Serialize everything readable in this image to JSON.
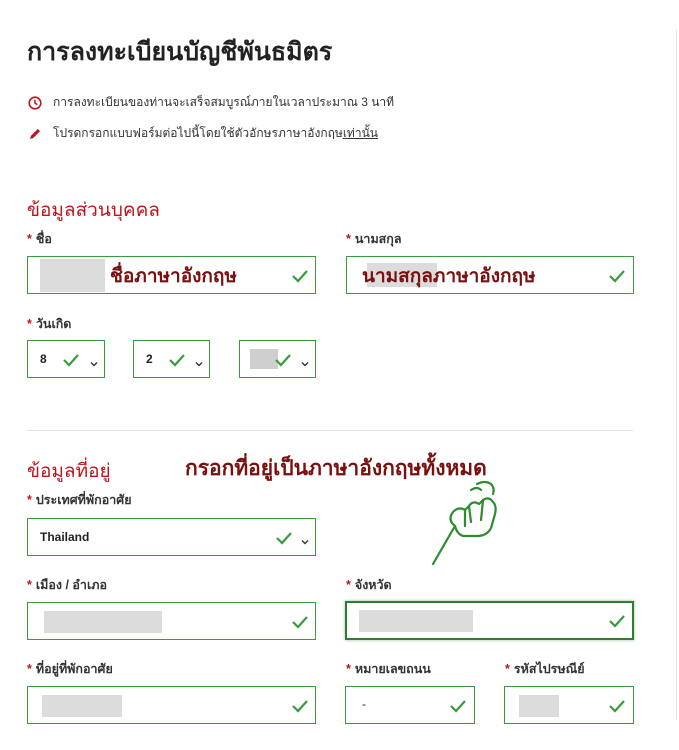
{
  "page": {
    "title": "การลงทะเบียนบัญชีพันธมิตร",
    "note_time": "การลงทะเบียนของท่านจะเสร็จสมบูรณ์ภายในเวลาประมาณ 3 นาที",
    "note_lang_prefix": "โปรดกรอกแบบฟอร์มต่อไปนี้โดยใช้ตัวอักษรภาษาอังกฤษ",
    "note_lang_underline": "เท่านั้น"
  },
  "personal": {
    "section_title": "ข้อมูลส่วนบุคคล",
    "required_mark": "*",
    "first_name_label": "ชื่อ",
    "last_name_label": "นามสกุล",
    "birth_label": "วันเกิด",
    "birth_day": "8",
    "birth_month": "2",
    "overlay_first": "ชื่อภาษาอังกฤษ",
    "overlay_last": "นามสกุลภาษาอังกฤษ"
  },
  "address": {
    "section_title": "ข้อมูลที่อยู่",
    "overlay_instruction": "กรอกที่อยู่เป็นภาษาอังกฤษทั้งหมด",
    "country_label": "ประเทศที่พักอาศัย",
    "country_value": "Thailand",
    "city_label": "เมือง / อำเภอ",
    "province_label": "จังหวัด",
    "address_label": "ที่อยู่ที่พักอาศัย",
    "street_no_label": "หมายเลขถนน",
    "street_no_value": "-",
    "postal_label": "รหัสไปรษณีย์"
  },
  "colors": {
    "accent_red": "#c0141b",
    "valid_green": "#3a9a3e",
    "overlay_text": "#7a0f0f",
    "hand_green": "#2e8b2e"
  },
  "icons": {
    "clock": "clock-icon",
    "pencil": "pencil-icon",
    "check": "check-icon",
    "caret": "chevron-down-icon",
    "hand": "pointing-hand-icon"
  }
}
